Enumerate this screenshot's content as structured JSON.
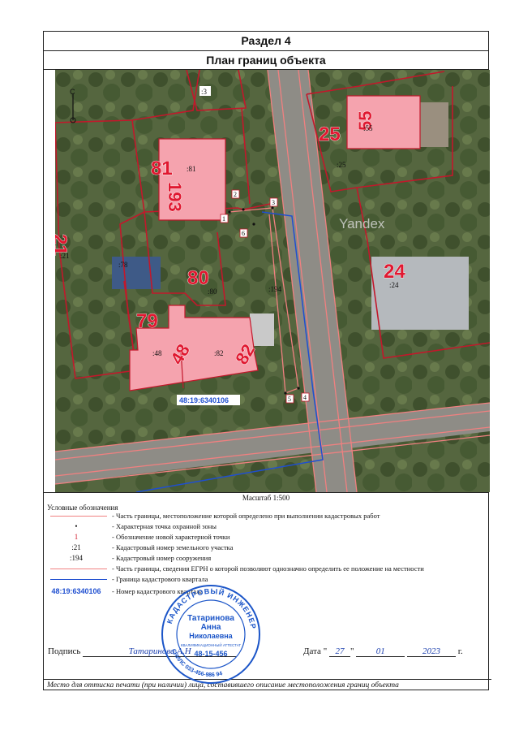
{
  "header": {
    "section": "Раздел 4",
    "title": "План границ объекта"
  },
  "map": {
    "watermark": "Yandex",
    "parcels": [
      {
        "big": "81",
        "small": ":81"
      },
      {
        "big": "193",
        "small": ""
      },
      {
        "big": "25",
        "small": ":25"
      },
      {
        "big": "55",
        "small": ":55"
      },
      {
        "big": "21",
        "small": ":21"
      },
      {
        "big": "80",
        "small": ":80"
      },
      {
        "big": "79",
        "small": ":79"
      },
      {
        "big": "48",
        "small": ":48"
      },
      {
        "big": "82",
        "small": ":82"
      },
      {
        "big": "24",
        "small": ":24"
      }
    ],
    "small_labels": [
      ":3",
      ":194",
      ":78"
    ],
    "points": [
      "1",
      "2",
      "3",
      "4",
      "5",
      "6"
    ],
    "quarter_label": "48:19:6340106",
    "north_letter": "C"
  },
  "scale_text": "Масштаб 1:500",
  "legend": {
    "title": "Условные обозначения",
    "items": [
      {
        "sym": "",
        "text": "- Часть границы, местоположение которой определено при выполнении кадастровых работ"
      },
      {
        "sym": "•",
        "text": "- Характерная точка охранной зоны"
      },
      {
        "sym": "1",
        "text": "- Обозначение новой характерной точки"
      },
      {
        "sym": ":21",
        "text": "- Кадастровый номер земельного участка"
      },
      {
        "sym": ":194",
        "text": "- Кадастровый номер сооружения"
      },
      {
        "sym": "",
        "text": "- Часть границы, сведения ЕГРН о которой позволяют однозначно определить ее положение на местности"
      },
      {
        "sym": "",
        "text": "- Граница кадастрового квартала"
      },
      {
        "sym": "48:19:6340106",
        "text": "- Номер кадастрового квартала"
      }
    ]
  },
  "signature": {
    "label": "Подпись",
    "value": "Татаринова А.Н"
  },
  "date": {
    "label": "Дата",
    "day": "27",
    "month": "01",
    "year": "2023",
    "suffix": "г."
  },
  "footer": "Место для оттиска печати (при наличии) лица, составившего описание местоположения границ объекта",
  "stamp": {
    "ring": "КАДАСТРОВЫЙ ИНЖЕНЕР",
    "name_line1": "Татаринова",
    "name_line2": "Анна",
    "name_line3": "Николаевна",
    "attest_label": "КВАЛИФИКАЦИОННЫЙ АТТЕСТАТ",
    "attest_no": "48-15-456",
    "snils": "СНИЛС 033-456-986 94"
  },
  "colors": {
    "parcel_fill": "#f5a3ae",
    "parcel_edge": "#c2182b",
    "egrn_line": "#f08080",
    "quarter_line": "#1f4fd0",
    "stamp_blue": "#1b55c8"
  }
}
